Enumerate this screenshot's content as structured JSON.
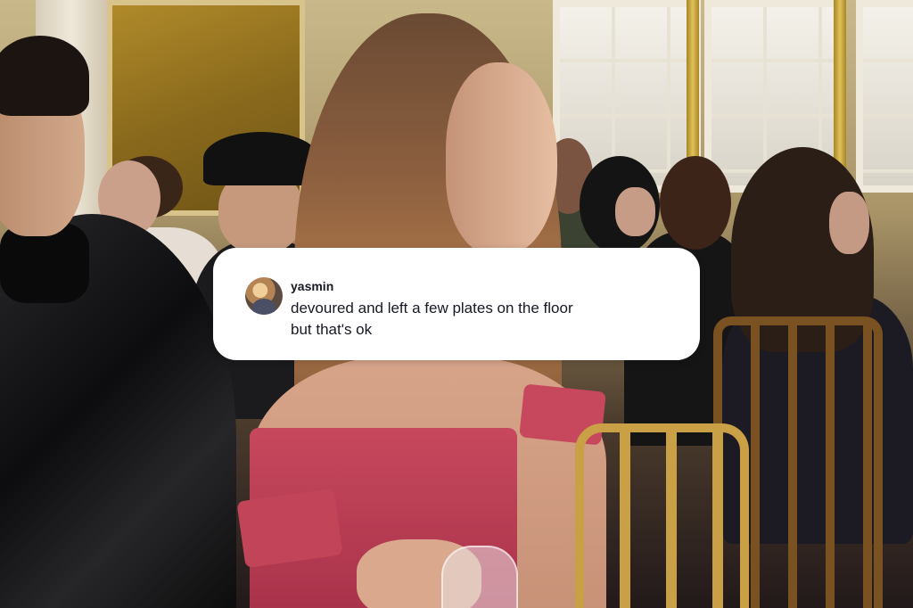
{
  "comment": {
    "username": "yasmin",
    "text": "devoured and left a few plates on the floor\nbut that's ok",
    "avatar_icon": "user-avatar-icon"
  },
  "colors": {
    "card_background": "#ffffff",
    "text": "#161823",
    "dress": "#c7485d",
    "chair_gold": "#c9a045"
  }
}
